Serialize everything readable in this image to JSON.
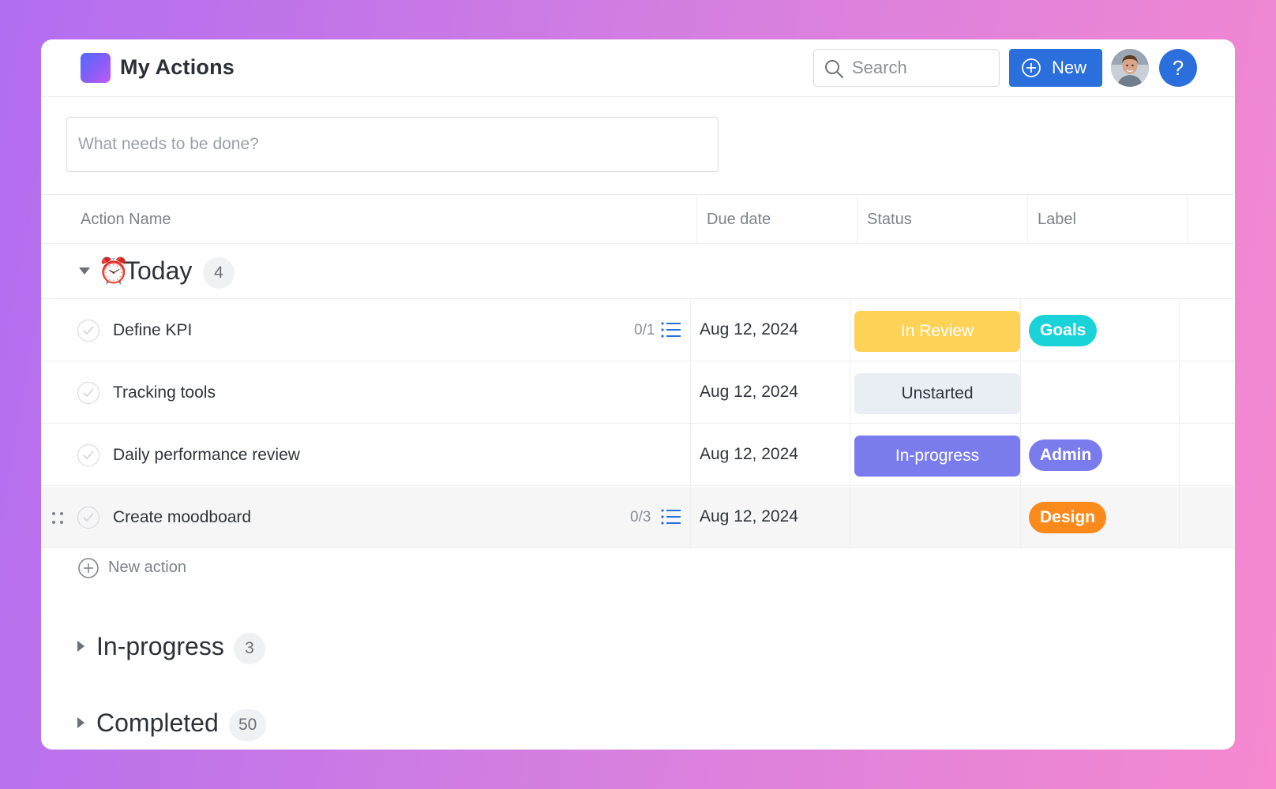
{
  "header": {
    "app_title": "My Actions",
    "search_placeholder": "Search",
    "new_button_label": "New",
    "help_label": "?"
  },
  "composer": {
    "placeholder": "What needs to be done?"
  },
  "columns": {
    "name": "Action Name",
    "due": "Due date",
    "status": "Status",
    "label": "Label"
  },
  "groups": {
    "today": {
      "emoji": "⏰",
      "title": "Today",
      "count": "4",
      "expanded": true,
      "rows": [
        {
          "name": "Define KPI",
          "subtasks": "0/1",
          "due": "Aug 12, 2024",
          "status": "In Review",
          "status_color": "#fdd256",
          "status_text_color": "#ffffff",
          "label": "Goals",
          "label_color": "#19d3d8"
        },
        {
          "name": "Tracking tools",
          "subtasks": "",
          "due": "Aug 12, 2024",
          "status": "Unstarted",
          "status_color": "#e9edf4",
          "status_text_color": "#2f343b",
          "label": "",
          "label_color": ""
        },
        {
          "name": "Daily performance review",
          "subtasks": "",
          "due": "Aug 12, 2024",
          "status": "In-progress",
          "status_color": "#7a7cee",
          "status_text_color": "#ffffff",
          "label": "Admin",
          "label_color": "#7a7cee"
        },
        {
          "name": "Create moodboard",
          "subtasks": "0/3",
          "due": "Aug 12, 2024",
          "status": "",
          "status_color": "",
          "status_text_color": "",
          "label": "Design",
          "label_color": "#fb8a1c"
        }
      ]
    },
    "in_progress": {
      "title": "In-progress",
      "count": "3",
      "expanded": false
    },
    "completed": {
      "title": "Completed",
      "count": "50",
      "expanded": false
    }
  },
  "new_action_label": "New action",
  "colors": {
    "accent": "#2a6fdb",
    "background_gradient_start": "#b26df0",
    "background_gradient_end": "#f689cf"
  },
  "icons": {
    "search": "magnifier",
    "new": "plus-circle",
    "check": "checkmark",
    "subtasks": "list",
    "drag": "drag-handle",
    "caret_expanded": "triangle-down",
    "caret_collapsed": "triangle-right"
  }
}
